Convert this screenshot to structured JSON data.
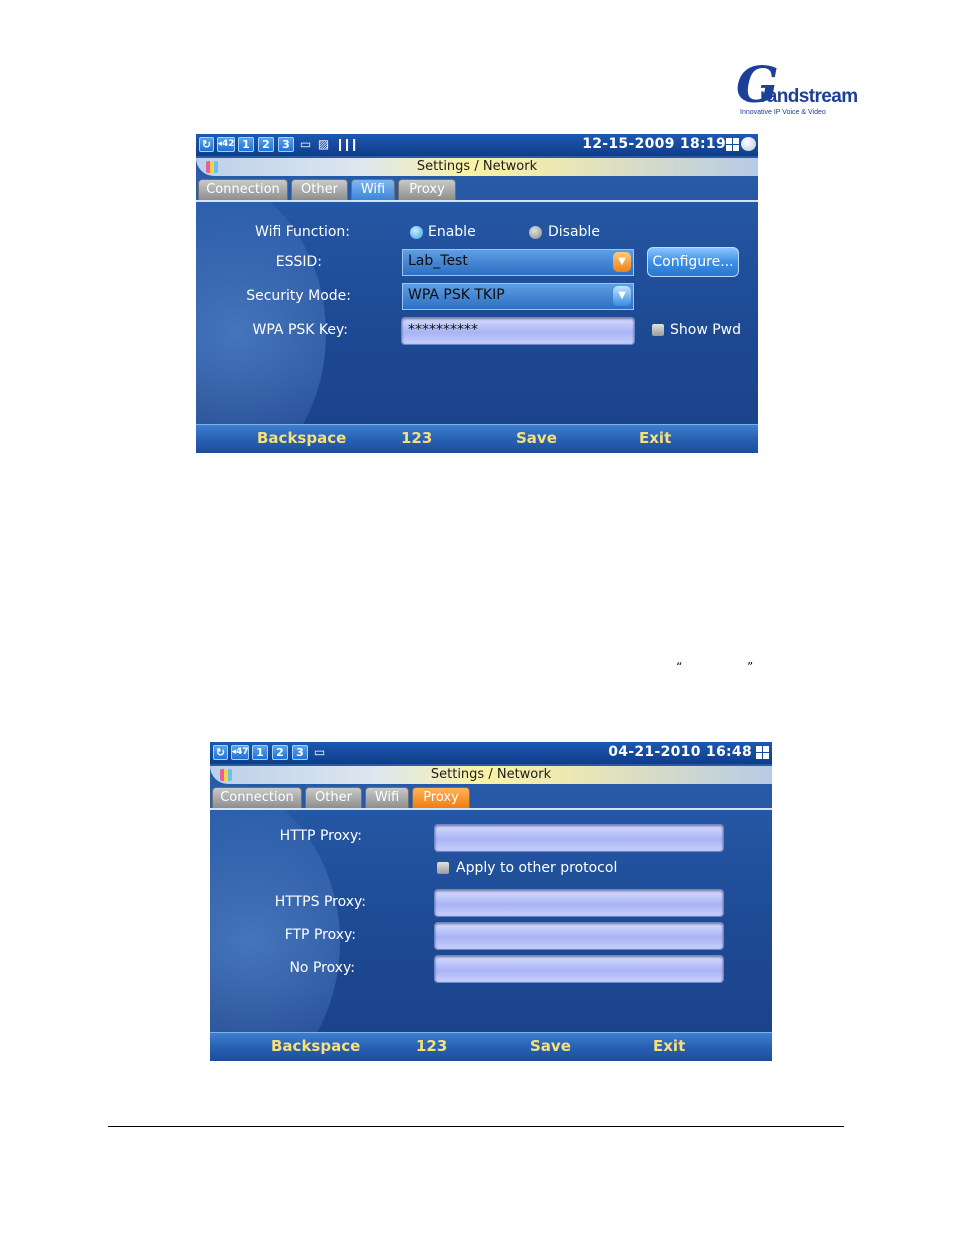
{
  "logo": {
    "mark": "G",
    "word": "randstream",
    "tagline": "Innovative IP Voice & Video"
  },
  "screen1": {
    "status": {
      "volume": "42",
      "lines": [
        "1",
        "2",
        "3"
      ],
      "datetime": "12-15-2009 18:19"
    },
    "title": "Settings / Network",
    "tabs": [
      "Connection",
      "Other",
      "Wifi",
      "Proxy"
    ],
    "active_tab": "Wifi",
    "form": {
      "wifi_function_label": "Wifi Function:",
      "enable_label": "Enable",
      "disable_label": "Disable",
      "wifi_function_value": "Enable",
      "essid_label": "ESSID:",
      "essid_value": "Lab_Test",
      "configure_button": "Configure...",
      "security_mode_label": "Security Mode:",
      "security_mode_value": "WPA PSK TKIP",
      "psk_key_label": "WPA PSK Key:",
      "psk_key_value": "**********",
      "show_pwd_label": "Show Pwd",
      "show_pwd_checked": false
    },
    "softkeys": [
      "Backspace",
      "123",
      "Save",
      "Exit"
    ]
  },
  "quotes": {
    "open": "“",
    "close": "”"
  },
  "screen2": {
    "status": {
      "volume": "47",
      "lines": [
        "1",
        "2",
        "3"
      ],
      "datetime": "04-21-2010 16:48"
    },
    "title": "Settings / Network",
    "tabs": [
      "Connection",
      "Other",
      "Wifi",
      "Proxy"
    ],
    "active_tab": "Proxy",
    "form": {
      "http_proxy_label": "HTTP Proxy:",
      "http_proxy_value": "",
      "apply_other_label": "Apply to other protocol",
      "apply_other_checked": false,
      "https_proxy_label": "HTTPS Proxy:",
      "https_proxy_value": "",
      "ftp_proxy_label": "FTP Proxy:",
      "ftp_proxy_value": "",
      "no_proxy_label": "No Proxy:",
      "no_proxy_value": ""
    },
    "softkeys": [
      "Backspace",
      "123",
      "Save",
      "Exit"
    ]
  },
  "icons": [
    "refresh-icon",
    "speaker-icon",
    "line-icon",
    "folder-icon",
    "network-icon",
    "signal-icon",
    "layout-grid-icon",
    "message-bubble-icon"
  ],
  "colors": {
    "softkey_text": "#f6e07a",
    "active_tab_blue": "#3c84d6",
    "active_tab_orange": "#f27c12",
    "screen_bg": "#1e4b95"
  }
}
